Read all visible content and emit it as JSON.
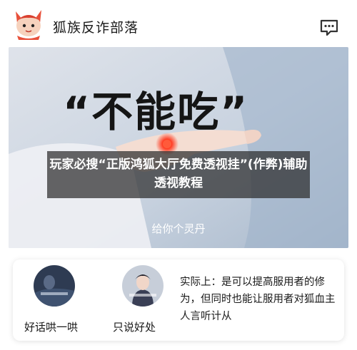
{
  "header": {
    "title": "狐族反诈部落",
    "logo_icon": "fox-mascot-icon",
    "message_icon": "chat-bubble-icon"
  },
  "hero": {
    "quote": "“不能吃”",
    "sub_caption": "给你个灵丹",
    "overlay_title": "玩家必搜“正版鸿狐大厅免费透视挂”(作弊)辅助透视教程"
  },
  "card": {
    "items": [
      {
        "label": "好话哄一哄",
        "thumb_icon": "dark-scene-thumbnail"
      },
      {
        "label": "只说好处",
        "thumb_icon": "costume-character-thumbnail"
      }
    ],
    "description": "实际上：是可以提高服用者的修为，但同时也能让服用者对狐血主人言听计从"
  },
  "colors": {
    "overlay": "#2d2d2d",
    "accent_red": "#e83a2a"
  }
}
